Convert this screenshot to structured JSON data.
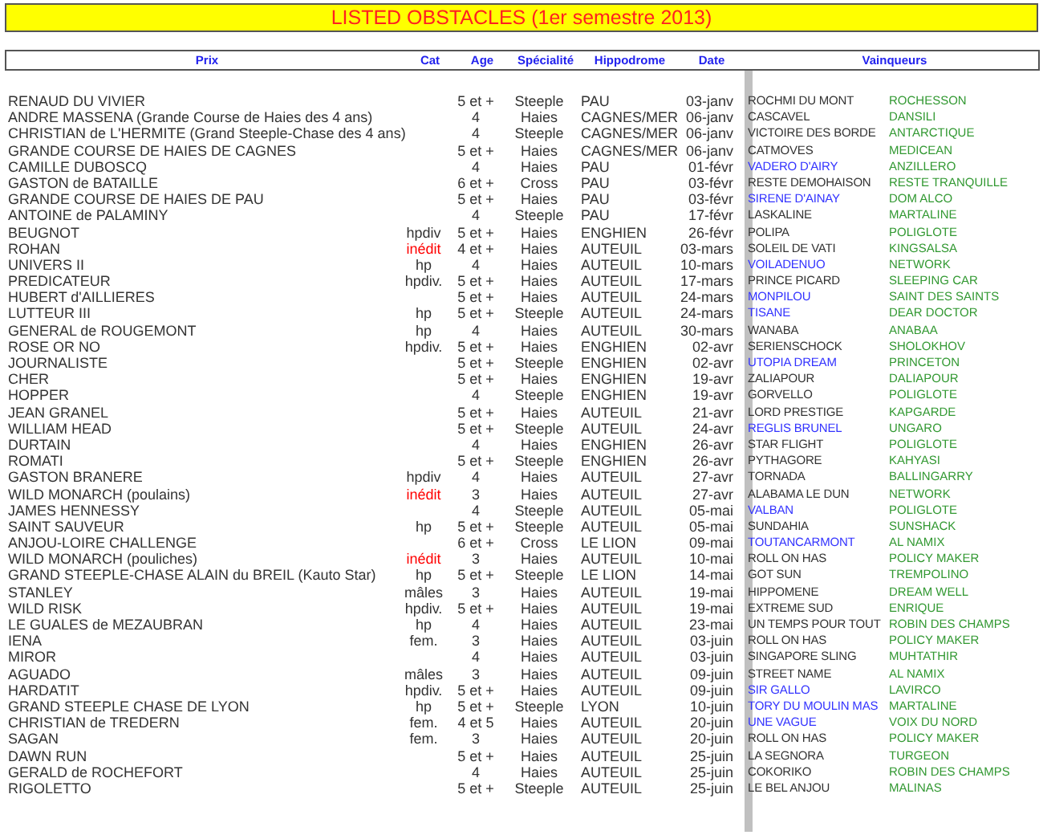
{
  "title": "LISTED OBSTACLES (1er semestre 2013)",
  "columns": {
    "prix": "Prix",
    "cat": "Cat",
    "age": "Age",
    "specialite": "Spécialité",
    "hippodrome": "Hippodrome",
    "date": "Date",
    "vainqueurs": "Vainqueurs"
  },
  "rows": [
    {
      "prix": "RENAUD DU VIVIER",
      "age": "5 et +",
      "specialite": "Steeple",
      "hippodrome": "PAU",
      "date": "03-janv",
      "winner": "ROCHMI DU MONT",
      "winner_marked": false,
      "sire": "ROCHESSON"
    },
    {
      "prix": "ANDRE MASSENA (Grande Course de Haies des 4 ans)",
      "age": "4",
      "specialite": "Haies",
      "hippodrome": "CAGNES/MER",
      "date": "06-janv",
      "winner": "CASCAVEL",
      "winner_marked": false,
      "sire": "DANSILI"
    },
    {
      "prix": "CHRISTIAN de L'HERMITE (Grand Steeple-Chase des 4 ans)",
      "age": "4",
      "specialite": "Steeple",
      "hippodrome": "CAGNES/MER",
      "date": "06-janv",
      "winner": "VICTOIRE DES BORDE",
      "winner_marked": false,
      "sire": "ANTARCTIQUE"
    },
    {
      "prix": "GRANDE COURSE DE HAIES DE CAGNES",
      "age": "5 et +",
      "specialite": "Haies",
      "hippodrome": "CAGNES/MER",
      "date": "06-janv",
      "winner": "CATMOVES",
      "winner_marked": false,
      "sire": "MEDICEAN"
    },
    {
      "prix": "CAMILLE DUBOSCQ",
      "age": "4",
      "specialite": "Haies",
      "hippodrome": "PAU",
      "date": "01-févr",
      "winner": "VADERO D'AIRY",
      "winner_marked": true,
      "sire": "ANZILLERO"
    },
    {
      "prix": "GASTON de BATAILLE",
      "age": "6 et +",
      "specialite": "Cross",
      "hippodrome": "PAU",
      "date": "03-févr",
      "winner": "RESTE DEMOHAISON",
      "winner_marked": false,
      "sire": "RESTE TRANQUILLE"
    },
    {
      "prix": "GRANDE COURSE DE HAIES DE PAU",
      "age": "5 et +",
      "specialite": "Haies",
      "hippodrome": "PAU",
      "date": "03-févr",
      "winner": "SIRENE D'AINAY",
      "winner_marked": true,
      "sire": "DOM ALCO"
    },
    {
      "prix": "ANTOINE de PALAMINY",
      "age": "4",
      "specialite": "Steeple",
      "hippodrome": "PAU",
      "date": "17-févr",
      "winner": "LASKALINE",
      "winner_marked": false,
      "sire": "MARTALINE"
    },
    {
      "prix": "BEUGNOT",
      "cat": "hpdiv",
      "cat_marked": false,
      "age": "5 et +",
      "specialite": "Haies",
      "hippodrome": "ENGHIEN",
      "date": "26-févr",
      "winner": "POLIPA",
      "winner_marked": false,
      "sire": "POLIGLOTE"
    },
    {
      "prix": "ROHAN",
      "cat": "inédit",
      "cat_marked": true,
      "age": "4 et +",
      "specialite": "Haies",
      "hippodrome": "AUTEUIL",
      "date": "03-mars",
      "winner": "SOLEIL DE VATI",
      "winner_marked": false,
      "sire": "KINGSALSA"
    },
    {
      "prix": "UNIVERS II",
      "cat": "hp",
      "cat_marked": false,
      "age": "4",
      "specialite": "Haies",
      "hippodrome": "AUTEUIL",
      "date": "10-mars",
      "winner": "VOILADENUO",
      "winner_marked": true,
      "sire": "NETWORK"
    },
    {
      "prix": "PREDICATEUR",
      "cat": "hpdiv.",
      "cat_marked": false,
      "age": "5 et +",
      "specialite": "Haies",
      "hippodrome": "AUTEUIL",
      "date": "17-mars",
      "winner": "PRINCE PICARD",
      "winner_marked": false,
      "sire": "SLEEPING CAR"
    },
    {
      "prix": "HUBERT d'AILLIERES",
      "age": "5 et +",
      "specialite": "Haies",
      "hippodrome": "AUTEUIL",
      "date": "24-mars",
      "winner": "MONPILOU",
      "winner_marked": true,
      "sire": "SAINT DES SAINTS"
    },
    {
      "prix": "LUTTEUR III",
      "cat": "hp",
      "cat_marked": false,
      "age": "5 et +",
      "specialite": "Steeple",
      "hippodrome": "AUTEUIL",
      "date": "24-mars",
      "winner": "TISANE",
      "winner_marked": true,
      "sire": "DEAR DOCTOR"
    },
    {
      "prix": "GENERAL de ROUGEMONT",
      "cat": "hp",
      "cat_marked": false,
      "age": "4",
      "specialite": "Haies",
      "hippodrome": "AUTEUIL",
      "date": "30-mars",
      "winner": "WANABA",
      "winner_marked": false,
      "sire": "ANABAA"
    },
    {
      "prix": "ROSE OR NO",
      "cat": "hpdiv.",
      "cat_marked": false,
      "age": "5 et +",
      "specialite": "Haies",
      "hippodrome": "ENGHIEN",
      "date": "02-avr",
      "winner": "SERIENSCHOCK",
      "winner_marked": false,
      "sire": "SHOLOKHOV"
    },
    {
      "prix": "JOURNALISTE",
      "age": "5 et +",
      "specialite": "Steeple",
      "hippodrome": "ENGHIEN",
      "date": "02-avr",
      "winner": "UTOPIA DREAM",
      "winner_marked": true,
      "sire": "PRINCETON"
    },
    {
      "prix": "CHER",
      "age": "5 et +",
      "specialite": "Haies",
      "hippodrome": "ENGHIEN",
      "date": "19-avr",
      "winner": "ZALIAPOUR",
      "winner_marked": false,
      "sire": "DALIAPOUR"
    },
    {
      "prix": "HOPPER",
      "age": "4",
      "specialite": "Steeple",
      "hippodrome": "ENGHIEN",
      "date": "19-avr",
      "winner": "GORVELLO",
      "winner_marked": false,
      "sire": "POLIGLOTE"
    },
    {
      "prix": "JEAN GRANEL",
      "age": "5 et +",
      "specialite": "Haies",
      "hippodrome": "AUTEUIL",
      "date": "21-avr",
      "winner": "LORD PRESTIGE",
      "winner_marked": false,
      "sire": "KAPGARDE"
    },
    {
      "prix": "WILLIAM HEAD",
      "age": "5 et +",
      "specialite": "Steeple",
      "hippodrome": "AUTEUIL",
      "date": "24-avr",
      "winner": "REGLIS BRUNEL",
      "winner_marked": true,
      "sire": "UNGARO"
    },
    {
      "prix": "DURTAIN",
      "age": "4",
      "specialite": "Haies",
      "hippodrome": "ENGHIEN",
      "date": "26-avr",
      "winner": "STAR FLIGHT",
      "winner_marked": false,
      "sire": "POLIGLOTE"
    },
    {
      "prix": "ROMATI",
      "age": "5 et +",
      "specialite": "Steeple",
      "hippodrome": "ENGHIEN",
      "date": "26-avr",
      "winner": "PYTHAGORE",
      "winner_marked": false,
      "sire": "KAHYASI"
    },
    {
      "prix": "GASTON BRANERE",
      "cat": "hpdiv",
      "cat_marked": false,
      "age": "4",
      "specialite": "Haies",
      "hippodrome": "AUTEUIL",
      "date": "27-avr",
      "winner": "TORNADA",
      "winner_marked": false,
      "sire": "BALLINGARRY"
    },
    {
      "prix": "WILD MONARCH (poulains)",
      "cat": "inédit",
      "cat_marked": true,
      "age": "3",
      "specialite": "Haies",
      "hippodrome": "AUTEUIL",
      "date": "27-avr",
      "winner": "ALABAMA LE DUN",
      "winner_marked": false,
      "sire": "NETWORK"
    },
    {
      "prix": "JAMES HENNESSY",
      "age": "4",
      "specialite": "Steeple",
      "hippodrome": "AUTEUIL",
      "date": "05-mai",
      "winner": "VALBAN",
      "winner_marked": true,
      "sire": "POLIGLOTE"
    },
    {
      "prix": "SAINT SAUVEUR",
      "cat": "hp",
      "cat_marked": false,
      "age": "5 et +",
      "specialite": "Steeple",
      "hippodrome": "AUTEUIL",
      "date": "05-mai",
      "winner": "SUNDAHIA",
      "winner_marked": false,
      "sire": "SUNSHACK"
    },
    {
      "prix": "ANJOU-LOIRE CHALLENGE",
      "age": "6 et +",
      "specialite": "Cross",
      "hippodrome": "LE LION",
      "date": "09-mai",
      "winner": "TOUTANCARMONT",
      "winner_marked": true,
      "sire": "AL NAMIX"
    },
    {
      "prix": "WILD MONARCH (pouliches)",
      "cat": "inédit",
      "cat_marked": true,
      "age": "3",
      "specialite": "Haies",
      "hippodrome": "AUTEUIL",
      "date": "10-mai",
      "winner": "ROLL ON HAS",
      "winner_marked": false,
      "sire": "POLICY MAKER"
    },
    {
      "prix": "GRAND STEEPLE-CHASE ALAIN du BREIL (Kauto Star)",
      "cat": "hp",
      "cat_marked": false,
      "age": "5 et +",
      "specialite": "Steeple",
      "hippodrome": "LE LION",
      "date": "14-mai",
      "winner": "GOT SUN",
      "winner_marked": false,
      "sire": "TREMPOLINO"
    },
    {
      "prix": "STANLEY",
      "cat": "mâles",
      "cat_marked": false,
      "age": "3",
      "specialite": "Haies",
      "hippodrome": "AUTEUIL",
      "date": "19-mai",
      "winner": "HIPPOMENE",
      "winner_marked": false,
      "sire": "DREAM WELL"
    },
    {
      "prix": "WILD RISK",
      "cat": "hpdiv.",
      "cat_marked": false,
      "age": "5 et +",
      "specialite": "Haies",
      "hippodrome": "AUTEUIL",
      "date": "19-mai",
      "winner": "EXTREME SUD",
      "winner_marked": false,
      "sire": "ENRIQUE"
    },
    {
      "prix": "LE GUALES de MEZAUBRAN",
      "cat": "hp",
      "cat_marked": false,
      "age": "4",
      "specialite": "Haies",
      "hippodrome": "AUTEUIL",
      "date": "23-mai",
      "winner": "UN TEMPS POUR TOUT",
      "winner_marked": false,
      "sire": "ROBIN DES CHAMPS"
    },
    {
      "prix": "IENA",
      "cat": "fem.",
      "cat_marked": false,
      "age": "3",
      "specialite": "Haies",
      "hippodrome": "AUTEUIL",
      "date": "03-juin",
      "winner": "ROLL ON HAS",
      "winner_marked": false,
      "sire": "POLICY MAKER"
    },
    {
      "prix": "MIROR",
      "age": "4",
      "specialite": "Haies",
      "hippodrome": "AUTEUIL",
      "date": "03-juin",
      "winner": "SINGAPORE SLING",
      "winner_marked": false,
      "sire": "MUHTATHIR"
    },
    {
      "prix": "AGUADO",
      "cat": "mâles",
      "cat_marked": false,
      "age": "3",
      "specialite": "Haies",
      "hippodrome": "AUTEUIL",
      "date": "09-juin",
      "winner": "STREET NAME",
      "winner_marked": false,
      "sire": "AL NAMIX"
    },
    {
      "prix": "HARDATIT",
      "cat": "hpdiv.",
      "cat_marked": false,
      "age": "5 et +",
      "specialite": "Haies",
      "hippodrome": "AUTEUIL",
      "date": "09-juin",
      "winner": "SIR GALLO",
      "winner_marked": true,
      "sire": "LAVIRCO"
    },
    {
      "prix": "GRAND STEEPLE CHASE DE LYON",
      "cat": "hp",
      "cat_marked": false,
      "age": "5 et +",
      "specialite": "Steeple",
      "hippodrome": "LYON",
      "date": "10-juin",
      "winner": "TORY DU MOULIN MAS",
      "winner_marked": true,
      "sire": "MARTALINE"
    },
    {
      "prix": "CHRISTIAN de TREDERN",
      "cat": "fem.",
      "cat_marked": false,
      "age": "4 et 5",
      "specialite": "Haies",
      "hippodrome": "AUTEUIL",
      "date": "20-juin",
      "winner": "UNE VAGUE",
      "winner_marked": true,
      "sire": "VOIX DU NORD"
    },
    {
      "prix": "SAGAN",
      "cat": "fem.",
      "cat_marked": false,
      "age": "3",
      "specialite": "Haies",
      "hippodrome": "AUTEUIL",
      "date": "20-juin",
      "winner": "ROLL ON HAS",
      "winner_marked": false,
      "sire": "POLICY MAKER"
    },
    {
      "prix": "DAWN RUN",
      "age": "5 et +",
      "specialite": "Haies",
      "hippodrome": "AUTEUIL",
      "date": "25-juin",
      "winner": "LA SEGNORA",
      "winner_marked": false,
      "sire": "TURGEON"
    },
    {
      "prix": "GERALD de ROCHEFORT",
      "age": "4",
      "specialite": "Haies",
      "hippodrome": "AUTEUIL",
      "date": "25-juin",
      "winner": "COKORIKO",
      "winner_marked": false,
      "sire": "ROBIN DES CHAMPS"
    },
    {
      "prix": "RIGOLETTO",
      "age": "5 et +",
      "specialite": "Steeple",
      "hippodrome": "AUTEUIL",
      "date": "25-juin",
      "winner": "LE BEL ANJOU",
      "winner_marked": false,
      "sire": "MALINAS"
    }
  ]
}
